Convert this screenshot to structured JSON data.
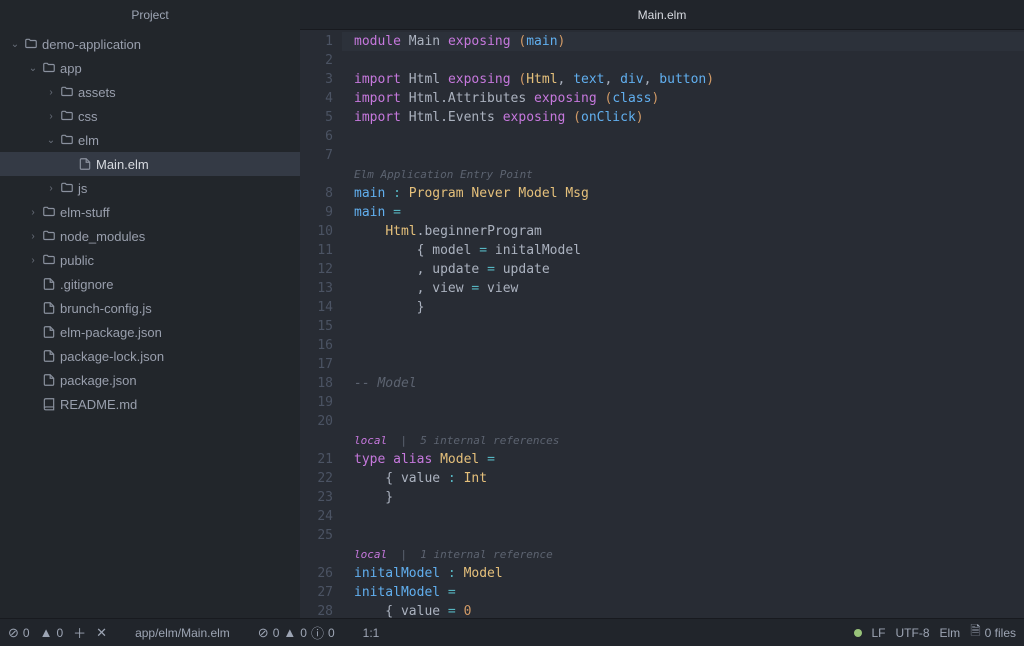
{
  "sidebar": {
    "title": "Project",
    "tree": [
      {
        "depth": 0,
        "chev": "down",
        "icon": "folder",
        "label": "demo-application"
      },
      {
        "depth": 1,
        "chev": "down",
        "icon": "folder",
        "label": "app"
      },
      {
        "depth": 2,
        "chev": "right",
        "icon": "folder",
        "label": "assets"
      },
      {
        "depth": 2,
        "chev": "right",
        "icon": "folder",
        "label": "css"
      },
      {
        "depth": 2,
        "chev": "down",
        "icon": "folder",
        "label": "elm"
      },
      {
        "depth": 3,
        "chev": "",
        "icon": "file",
        "label": "Main.elm",
        "selected": true
      },
      {
        "depth": 2,
        "chev": "right",
        "icon": "folder",
        "label": "js"
      },
      {
        "depth": 1,
        "chev": "right",
        "icon": "folder",
        "label": "elm-stuff"
      },
      {
        "depth": 1,
        "chev": "right",
        "icon": "folder",
        "label": "node_modules"
      },
      {
        "depth": 1,
        "chev": "right",
        "icon": "folder",
        "label": "public"
      },
      {
        "depth": 1,
        "chev": "",
        "icon": "file",
        "label": ".gitignore"
      },
      {
        "depth": 1,
        "chev": "",
        "icon": "file",
        "label": "brunch-config.js"
      },
      {
        "depth": 1,
        "chev": "",
        "icon": "file",
        "label": "elm-package.json"
      },
      {
        "depth": 1,
        "chev": "",
        "icon": "file",
        "label": "package-lock.json"
      },
      {
        "depth": 1,
        "chev": "",
        "icon": "file",
        "label": "package.json"
      },
      {
        "depth": 1,
        "chev": "",
        "icon": "book",
        "label": "README.md"
      }
    ]
  },
  "tab": {
    "title": "Main.elm"
  },
  "code": [
    {
      "n": 1,
      "cursor": true,
      "t": [
        [
          "keyword",
          "module"
        ],
        [
          "ident",
          " Main "
        ],
        [
          "keyword",
          "exposing"
        ],
        [
          "ident",
          " "
        ],
        [
          "paren",
          "("
        ],
        [
          "func",
          "main"
        ],
        [
          "paren",
          ")"
        ]
      ]
    },
    {
      "n": 2,
      "t": []
    },
    {
      "n": 3,
      "t": [
        [
          "keyword",
          "import"
        ],
        [
          "ident",
          " Html "
        ],
        [
          "keyword",
          "exposing"
        ],
        [
          "ident",
          " "
        ],
        [
          "paren",
          "("
        ],
        [
          "type",
          "Html"
        ],
        [
          "comma",
          ", "
        ],
        [
          "func",
          "text"
        ],
        [
          "comma",
          ", "
        ],
        [
          "func",
          "div"
        ],
        [
          "comma",
          ", "
        ],
        [
          "func",
          "button"
        ],
        [
          "paren",
          ")"
        ]
      ]
    },
    {
      "n": 4,
      "t": [
        [
          "keyword",
          "import"
        ],
        [
          "ident",
          " Html.Attributes "
        ],
        [
          "keyword",
          "exposing"
        ],
        [
          "ident",
          " "
        ],
        [
          "paren",
          "("
        ],
        [
          "func",
          "class"
        ],
        [
          "paren",
          ")"
        ]
      ]
    },
    {
      "n": 5,
      "t": [
        [
          "keyword",
          "import"
        ],
        [
          "ident",
          " Html.Events "
        ],
        [
          "keyword",
          "exposing"
        ],
        [
          "ident",
          " "
        ],
        [
          "paren",
          "("
        ],
        [
          "func",
          "onClick"
        ],
        [
          "paren",
          ")"
        ]
      ]
    },
    {
      "n": 6,
      "t": []
    },
    {
      "n": 7,
      "t": []
    },
    {
      "n": null,
      "annot": true,
      "t": [
        [
          "annot",
          "Elm Application Entry Point"
        ]
      ]
    },
    {
      "n": 8,
      "t": [
        [
          "func",
          "main"
        ],
        [
          "ident",
          " "
        ],
        [
          "op",
          ":"
        ],
        [
          "ident",
          " "
        ],
        [
          "type",
          "Program"
        ],
        [
          "ident",
          " "
        ],
        [
          "type",
          "Never"
        ],
        [
          "ident",
          " "
        ],
        [
          "type",
          "Model"
        ],
        [
          "ident",
          " "
        ],
        [
          "type",
          "Msg"
        ]
      ]
    },
    {
      "n": 9,
      "t": [
        [
          "func",
          "main"
        ],
        [
          "ident",
          " "
        ],
        [
          "op",
          "="
        ]
      ]
    },
    {
      "n": 10,
      "t": [
        [
          "ident",
          "    "
        ],
        [
          "type",
          "Html"
        ],
        [
          "ident",
          ".beginnerProgram"
        ]
      ]
    },
    {
      "n": 11,
      "t": [
        [
          "ident",
          "        { model "
        ],
        [
          "op",
          "="
        ],
        [
          "ident",
          " initalModel"
        ]
      ]
    },
    {
      "n": 12,
      "t": [
        [
          "ident",
          "        , update "
        ],
        [
          "op",
          "="
        ],
        [
          "ident",
          " update"
        ]
      ]
    },
    {
      "n": 13,
      "t": [
        [
          "ident",
          "        , view "
        ],
        [
          "op",
          "="
        ],
        [
          "ident",
          " view"
        ]
      ]
    },
    {
      "n": 14,
      "t": [
        [
          "ident",
          "        }"
        ]
      ]
    },
    {
      "n": 15,
      "t": []
    },
    {
      "n": 16,
      "t": []
    },
    {
      "n": 17,
      "t": []
    },
    {
      "n": 18,
      "t": [
        [
          "comment",
          "-- Model"
        ]
      ]
    },
    {
      "n": 19,
      "t": []
    },
    {
      "n": 20,
      "t": []
    },
    {
      "n": null,
      "annot": true,
      "t": [
        [
          "annot-kw",
          "local"
        ],
        [
          "sep",
          "  |  "
        ],
        [
          "annot",
          "5 internal references"
        ]
      ]
    },
    {
      "n": 21,
      "t": [
        [
          "keyword",
          "type"
        ],
        [
          "ident",
          " "
        ],
        [
          "keyword",
          "alias"
        ],
        [
          "ident",
          " "
        ],
        [
          "type",
          "Model"
        ],
        [
          "ident",
          " "
        ],
        [
          "op",
          "="
        ]
      ]
    },
    {
      "n": 22,
      "t": [
        [
          "ident",
          "    { value "
        ],
        [
          "op",
          ":"
        ],
        [
          "ident",
          " "
        ],
        [
          "type",
          "Int"
        ]
      ]
    },
    {
      "n": 23,
      "t": [
        [
          "ident",
          "    }"
        ]
      ]
    },
    {
      "n": 24,
      "t": []
    },
    {
      "n": 25,
      "t": []
    },
    {
      "n": null,
      "annot": true,
      "t": [
        [
          "annot-kw",
          "local"
        ],
        [
          "sep",
          "  |  "
        ],
        [
          "annot",
          "1 internal reference"
        ]
      ]
    },
    {
      "n": 26,
      "t": [
        [
          "func",
          "initalModel"
        ],
        [
          "ident",
          " "
        ],
        [
          "op",
          ":"
        ],
        [
          "ident",
          " "
        ],
        [
          "type",
          "Model"
        ]
      ]
    },
    {
      "n": 27,
      "t": [
        [
          "func",
          "initalModel"
        ],
        [
          "ident",
          " "
        ],
        [
          "op",
          "="
        ]
      ]
    },
    {
      "n": 28,
      "t": [
        [
          "ident",
          "    { value "
        ],
        [
          "op",
          "="
        ],
        [
          "ident",
          " "
        ],
        [
          "num",
          "0"
        ]
      ]
    }
  ],
  "status": {
    "errors": "0",
    "warnings": "0",
    "info": "0",
    "path": "app/elm/Main.elm",
    "diag_errors": "0",
    "diag_warnings": "0",
    "diag_info": "0",
    "cursor": "1:1",
    "line_ending": "LF",
    "encoding": "UTF-8",
    "language": "Elm",
    "files": "0 files"
  }
}
